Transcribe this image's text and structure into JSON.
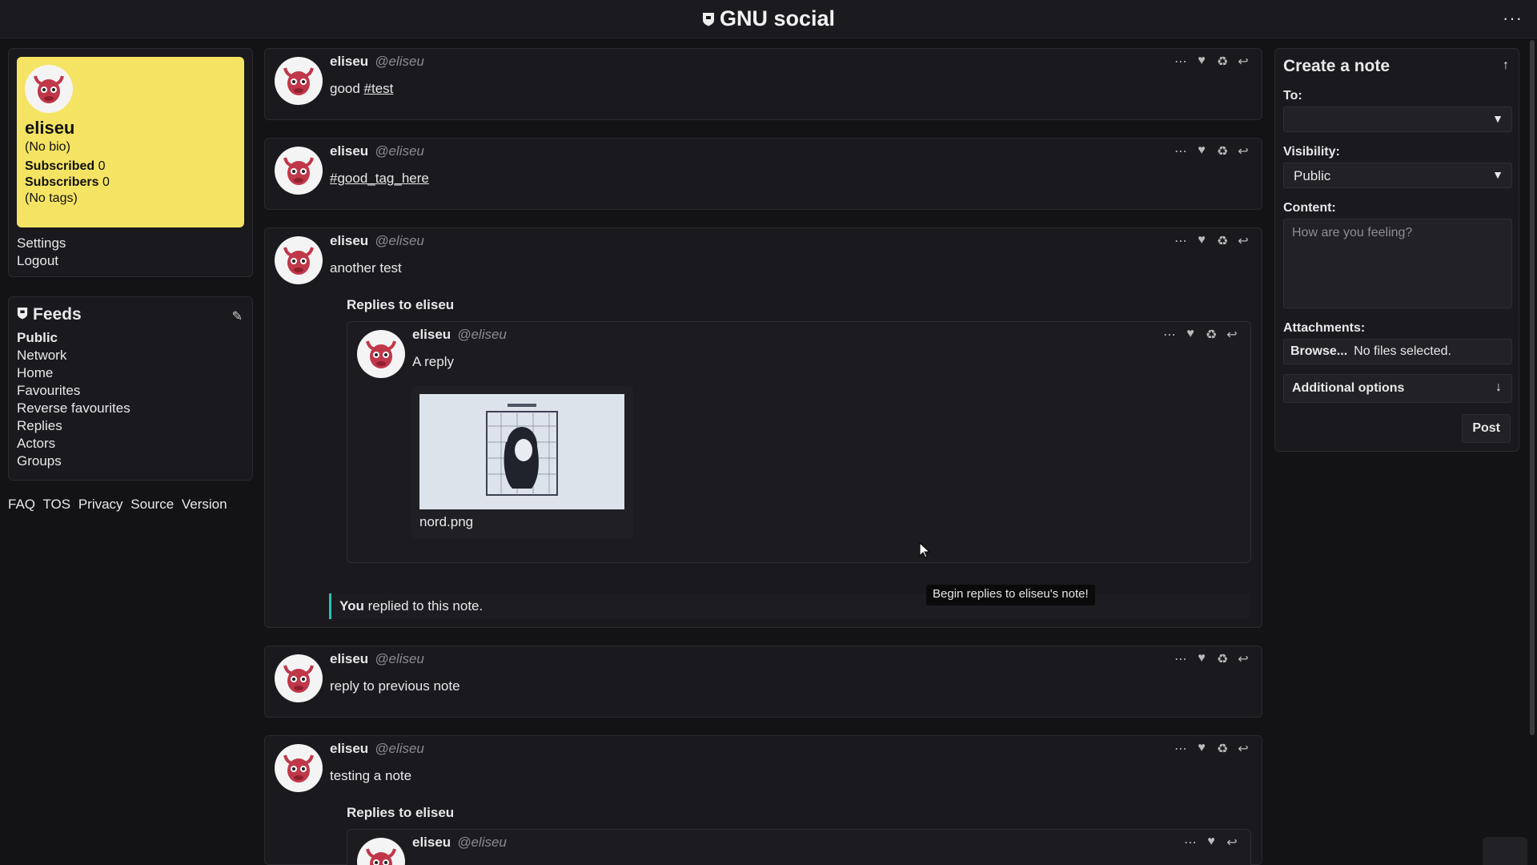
{
  "colors": {
    "background": "#131316",
    "profile_card": "#f5e463",
    "reply_accent": "#2ac2b6",
    "avatar_red": "#c0374a"
  },
  "header": {
    "brand": "GNU social",
    "menu_icon": "more-dots-icon"
  },
  "profile": {
    "name": "eliseu",
    "bio": "(No bio)",
    "subscribed_label": "Subscribed",
    "subscribed_count": "0",
    "subscribers_label": "Subscribers",
    "subscribers_count": "0",
    "tags": "(No tags)"
  },
  "side_links": [
    "Settings",
    "Logout"
  ],
  "feeds": {
    "title": "Feeds",
    "items": [
      {
        "label": "Public",
        "active": true
      },
      {
        "label": "Network"
      },
      {
        "label": "Home"
      },
      {
        "label": "Favourites"
      },
      {
        "label": "Reverse favourites"
      },
      {
        "label": "Replies"
      },
      {
        "label": "Actors"
      },
      {
        "label": "Groups"
      }
    ]
  },
  "footer_links": [
    "FAQ",
    "TOS",
    "Privacy",
    "Source",
    "Version"
  ],
  "notes": [
    {
      "author": "eliseu",
      "handle": "@eliseu",
      "content": "good ",
      "tag": "#test"
    },
    {
      "author": "eliseu",
      "handle": "@eliseu",
      "content": "",
      "tag": "#good_tag_here"
    },
    {
      "author": "eliseu",
      "handle": "@eliseu",
      "content": "another test",
      "replies_title": "Replies to eliseu",
      "reply": {
        "author": "eliseu",
        "handle": "@eliseu",
        "content": "A reply",
        "attachment_name": "nord.png"
      },
      "replied_you": "You",
      "replied_text": " replied to this note."
    },
    {
      "author": "eliseu",
      "handle": "@eliseu",
      "content": "reply to previous note"
    },
    {
      "author": "eliseu",
      "handle": "@eliseu",
      "content": "testing a note",
      "replies_title": "Replies to eliseu",
      "reply": {
        "author": "eliseu",
        "handle": "@eliseu"
      }
    }
  ],
  "tooltip": "Begin replies to eliseu's note!",
  "create_note": {
    "title": "Create a note",
    "to_label": "To:",
    "to_value": "",
    "visibility_label": "Visibility:",
    "visibility_value": "Public",
    "content_label": "Content:",
    "content_placeholder": "How are you feeling?",
    "attachments_label": "Attachments:",
    "browse_label": "Browse...",
    "no_files": "No files selected.",
    "additional_options": "Additional options",
    "post_label": "Post"
  }
}
